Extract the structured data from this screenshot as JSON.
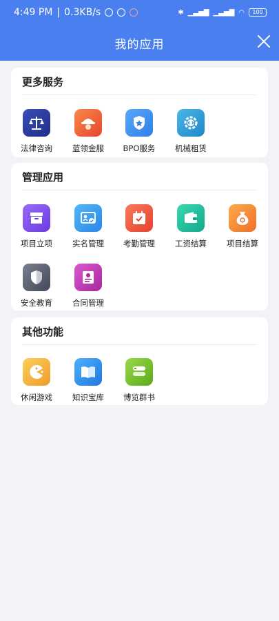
{
  "status": {
    "time": "4:49 PM",
    "speed": "0.3KB/s",
    "battery": "100"
  },
  "header": {
    "title": "我的应用"
  },
  "sections": [
    {
      "title": "更多服务",
      "items": [
        {
          "label": "法律咨询",
          "icon": "scales-icon",
          "color": "#2d3fa0"
        },
        {
          "label": "蓝领金服",
          "icon": "worker-helmet-icon",
          "color": "#ef5a3a"
        },
        {
          "label": "BPO服务",
          "icon": "shield-star-icon",
          "color": "#3f8ff5"
        },
        {
          "label": "机械租赁",
          "icon": "gear-code-icon",
          "color": "#2f9fd8"
        }
      ]
    },
    {
      "title": "管理应用",
      "items": [
        {
          "label": "项目立项",
          "icon": "archive-box-icon",
          "color": "#7a4cf0"
        },
        {
          "label": "实名管理",
          "icon": "id-card-check-icon",
          "color": "#2f9ff0"
        },
        {
          "label": "考勤管理",
          "icon": "calendar-check-icon",
          "color": "#f0553c"
        },
        {
          "label": "工资结算",
          "icon": "wallet-icon",
          "color": "#1fbf9f"
        },
        {
          "label": "项目结算",
          "icon": "money-bag-icon",
          "color": "#f78a2a"
        },
        {
          "label": "安全教育",
          "icon": "shield-icon",
          "color": "#5d6270"
        },
        {
          "label": "合同管理",
          "icon": "certificate-icon",
          "color": "#c03ab8"
        }
      ]
    },
    {
      "title": "其他功能",
      "items": [
        {
          "label": "休闲游戏",
          "icon": "pacman-icon",
          "color": "#f5b23a"
        },
        {
          "label": "知识宝库",
          "icon": "open-book-icon",
          "color": "#2f8ff0"
        },
        {
          "label": "博览群书",
          "icon": "book-stack-icon",
          "color": "#7ac32a"
        }
      ]
    }
  ]
}
